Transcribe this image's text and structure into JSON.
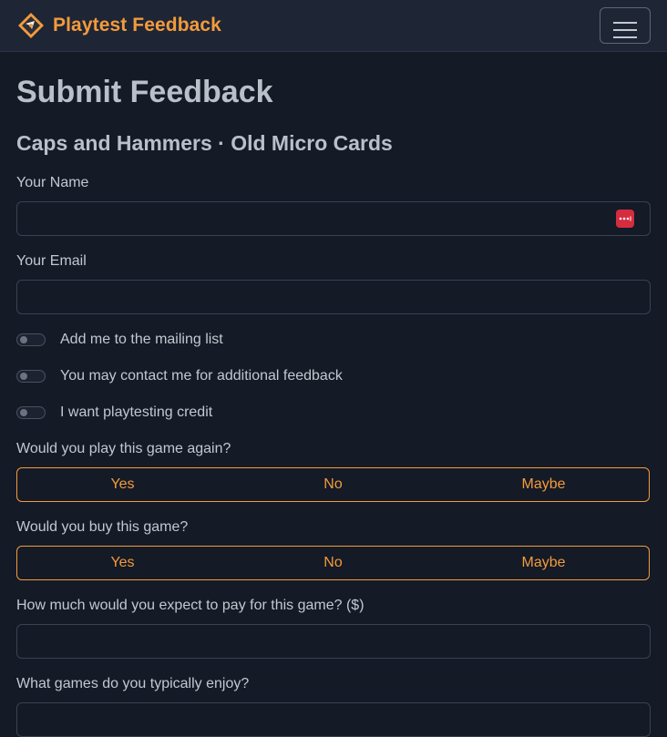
{
  "app": {
    "brand": "Playtest Feedback"
  },
  "page": {
    "title": "Submit Feedback",
    "subtitle": "Caps and Hammers · Old Micro Cards"
  },
  "form": {
    "name_label": "Your Name",
    "name_value": "",
    "email_label": "Your Email",
    "email_value": "",
    "switches": [
      {
        "label": "Add me to the mailing list",
        "checked": false
      },
      {
        "label": "You may contact me for additional feedback",
        "checked": false
      },
      {
        "label": "I want playtesting credit",
        "checked": false
      }
    ],
    "play_again": {
      "label": "Would you play this game again?",
      "options": [
        "Yes",
        "No",
        "Maybe"
      ]
    },
    "buy": {
      "label": "Would you buy this game?",
      "options": [
        "Yes",
        "No",
        "Maybe"
      ]
    },
    "price_label": "How much would you expect to pay for this game? ($)",
    "price_value": "",
    "games_label": "What games do you typically enjoy?",
    "games_value": ""
  },
  "colors": {
    "accent": "#f39b3c",
    "background": "#141a26",
    "navbar": "#1e2535",
    "password_manager": "#d32d3f"
  },
  "icons": {
    "logo": "diamond-compass-logo",
    "menu": "hamburger-menu-icon",
    "password_manager": "password-manager-icon"
  }
}
